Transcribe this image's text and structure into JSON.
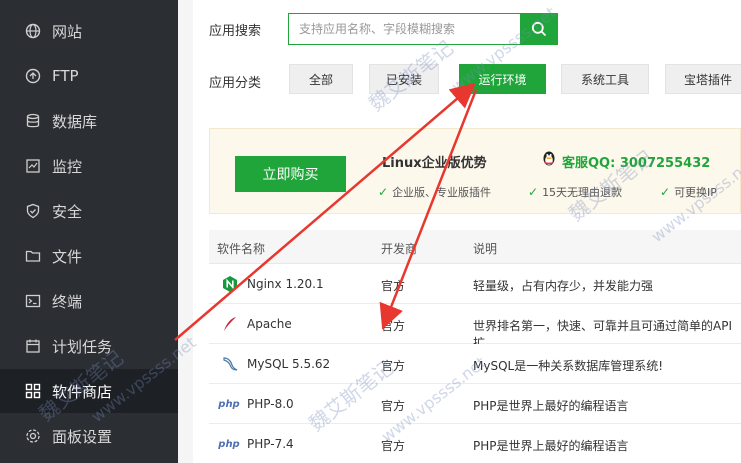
{
  "sidebar": {
    "items": [
      {
        "label": "网站",
        "icon": "globe-icon"
      },
      {
        "label": "FTP",
        "icon": "ftp-icon"
      },
      {
        "label": "数据库",
        "icon": "database-icon"
      },
      {
        "label": "监控",
        "icon": "monitor-icon"
      },
      {
        "label": "安全",
        "icon": "shield-icon"
      },
      {
        "label": "文件",
        "icon": "folder-icon"
      },
      {
        "label": "终端",
        "icon": "terminal-icon"
      },
      {
        "label": "计划任务",
        "icon": "calendar-icon"
      },
      {
        "label": "软件商店",
        "icon": "apps-icon",
        "active": true
      },
      {
        "label": "面板设置",
        "icon": "gear-icon"
      }
    ]
  },
  "search": {
    "label": "应用搜索",
    "placeholder": "支持应用名称、字段模糊搜索"
  },
  "category": {
    "label": "应用分类",
    "buttons": [
      "全部",
      "已安装",
      "运行环境",
      "系统工具",
      "宝塔插件"
    ],
    "active": "运行环境"
  },
  "promo": {
    "buy_label": "立即购买",
    "title": "Linux企业版优势",
    "qq": "客服QQ: 3007255432",
    "features": [
      "企业版、专业版插件",
      "15天无理由退款",
      "可更换IP"
    ]
  },
  "table": {
    "headers": [
      "软件名称",
      "开发商",
      "说明"
    ],
    "rows": [
      {
        "name": "Nginx 1.20.1",
        "icon": "nginx-icon",
        "dev": "官方",
        "desc": "轻量级，占有内存少，并发能力强"
      },
      {
        "name": "Apache",
        "icon": "apache-feather-icon",
        "dev": "官方",
        "desc": "世界排名第一，快速、可靠并且可通过简单的API扩"
      },
      {
        "name": "MySQL 5.5.62",
        "icon": "mysql-dolphin-icon",
        "dev": "官方",
        "desc": "MySQL是一种关系数据库管理系统!"
      },
      {
        "name": "PHP-8.0",
        "icon": "php-icon",
        "dev": "官方",
        "desc": "PHP是世界上最好的编程语言"
      },
      {
        "name": "PHP-7.4",
        "icon": "php-icon",
        "dev": "官方",
        "desc": "PHP是世界上最好的编程语言"
      }
    ]
  },
  "php_icon_text": "php",
  "watermarks": [
    "魏艾斯笔记",
    "www.vpssss.net"
  ],
  "colors": {
    "accent": "#20a53a",
    "sidebar": "#2b2e33",
    "arrow": "#e8372f"
  }
}
